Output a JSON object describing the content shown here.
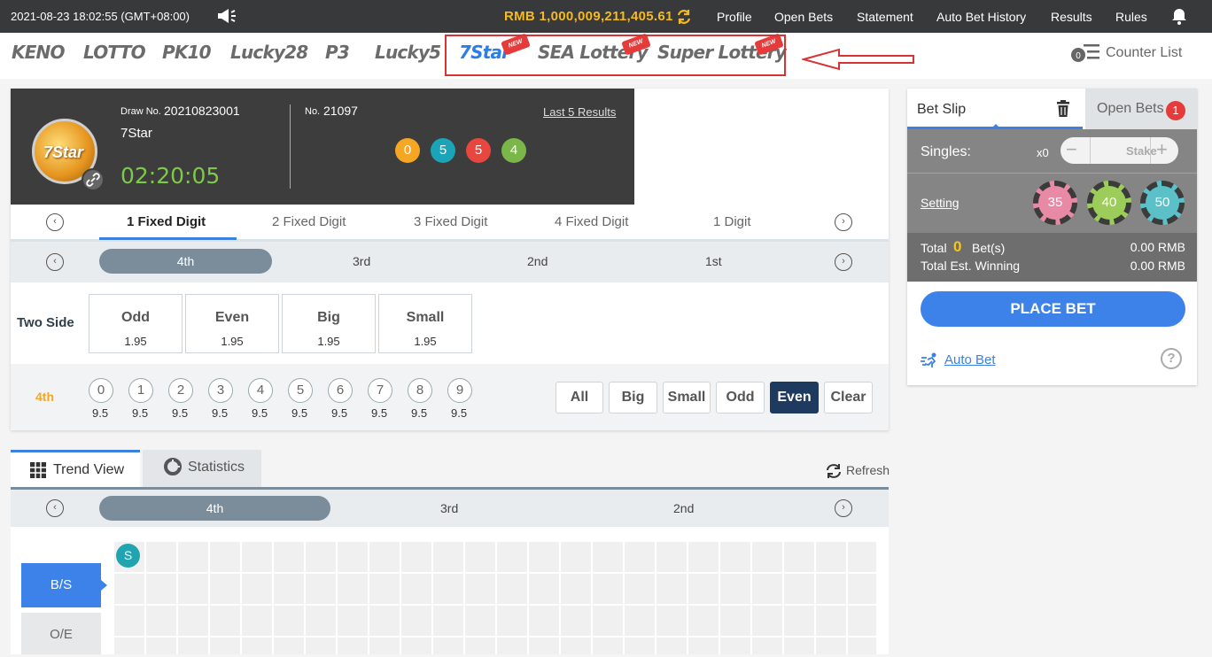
{
  "topbar": {
    "datetime": "2021-08-23 18:02:55 (GMT+08:00)",
    "balance": "RMB 1,000,009,211,405.61",
    "nav": [
      "Profile",
      "Open Bets",
      "Statement",
      "Auto Bet History",
      "Results",
      "Rules"
    ]
  },
  "games": {
    "items": [
      {
        "label": "KENO",
        "active": false,
        "new": false
      },
      {
        "label": "LOTTO",
        "active": false,
        "new": false
      },
      {
        "label": "PK10",
        "active": false,
        "new": false
      },
      {
        "label": "Lucky28",
        "active": false,
        "new": false
      },
      {
        "label": "P3",
        "active": false,
        "new": false
      },
      {
        "label": "Lucky5",
        "active": false,
        "new": false
      },
      {
        "label": "7Star",
        "active": true,
        "new": true
      },
      {
        "label": "SEA Lottery",
        "active": false,
        "new": true
      },
      {
        "label": "Super Lottery",
        "active": false,
        "new": true
      }
    ],
    "new_badge": "NEW",
    "counter_list": "Counter List",
    "counter_count": "0"
  },
  "draw": {
    "logo_text": "7Star",
    "draw_label": "Draw No.",
    "draw_no": "20210823001",
    "game_name": "7Star",
    "timer": "02:20:05",
    "no_label": "No.",
    "no_value": "21097",
    "last5": "Last 5 Results",
    "results": [
      {
        "value": "0",
        "color": "#f5a623"
      },
      {
        "value": "5",
        "color": "#1ba3b8"
      },
      {
        "value": "5",
        "color": "#e8473f"
      },
      {
        "value": "4",
        "color": "#7ab648"
      }
    ]
  },
  "bet_types": [
    "1 Fixed Digit",
    "2 Fixed Digit",
    "3 Fixed Digit",
    "4 Fixed Digit",
    "1 Digit"
  ],
  "positions": [
    "4th",
    "3rd",
    "2nd",
    "1st"
  ],
  "two_side": {
    "label": "Two Side",
    "options": [
      {
        "name": "Odd",
        "odds": "1.95"
      },
      {
        "name": "Even",
        "odds": "1.95"
      },
      {
        "name": "Big",
        "odds": "1.95"
      },
      {
        "name": "Small",
        "odds": "1.95"
      }
    ]
  },
  "digits": {
    "label": "4th",
    "numbers": [
      "0",
      "1",
      "2",
      "3",
      "4",
      "5",
      "6",
      "7",
      "8",
      "9"
    ],
    "odds": "9.5",
    "quick": [
      "All",
      "Big",
      "Small",
      "Odd",
      "Even",
      "Clear"
    ],
    "quick_active": "Even"
  },
  "trend": {
    "tab_trend": "Trend View",
    "tab_stats": "Statistics",
    "refresh": "Refresh",
    "positions": [
      "4th",
      "3rd",
      "2nd"
    ],
    "bs": "B/S",
    "oe": "O/E",
    "first_mark": "S"
  },
  "betslip": {
    "tab": "Bet Slip",
    "open_bets": "Open Bets",
    "open_count": "1",
    "singles": "Singles:",
    "multiplier": "x0",
    "stake_placeholder": "Stake",
    "setting": "Setting",
    "chips": [
      {
        "value": "35",
        "color": "#e88aa5"
      },
      {
        "value": "40",
        "color": "#9ccc5a"
      },
      {
        "value": "50",
        "color": "#5bc0c7"
      }
    ],
    "total_label": "Total",
    "total_count": "0",
    "bets_label": "Bet(s)",
    "total_amount": "0.00 RMB",
    "est_label": "Total Est. Winning",
    "est_amount": "0.00 RMB",
    "place_bet": "PLACE BET",
    "auto_bet": "Auto Bet"
  }
}
